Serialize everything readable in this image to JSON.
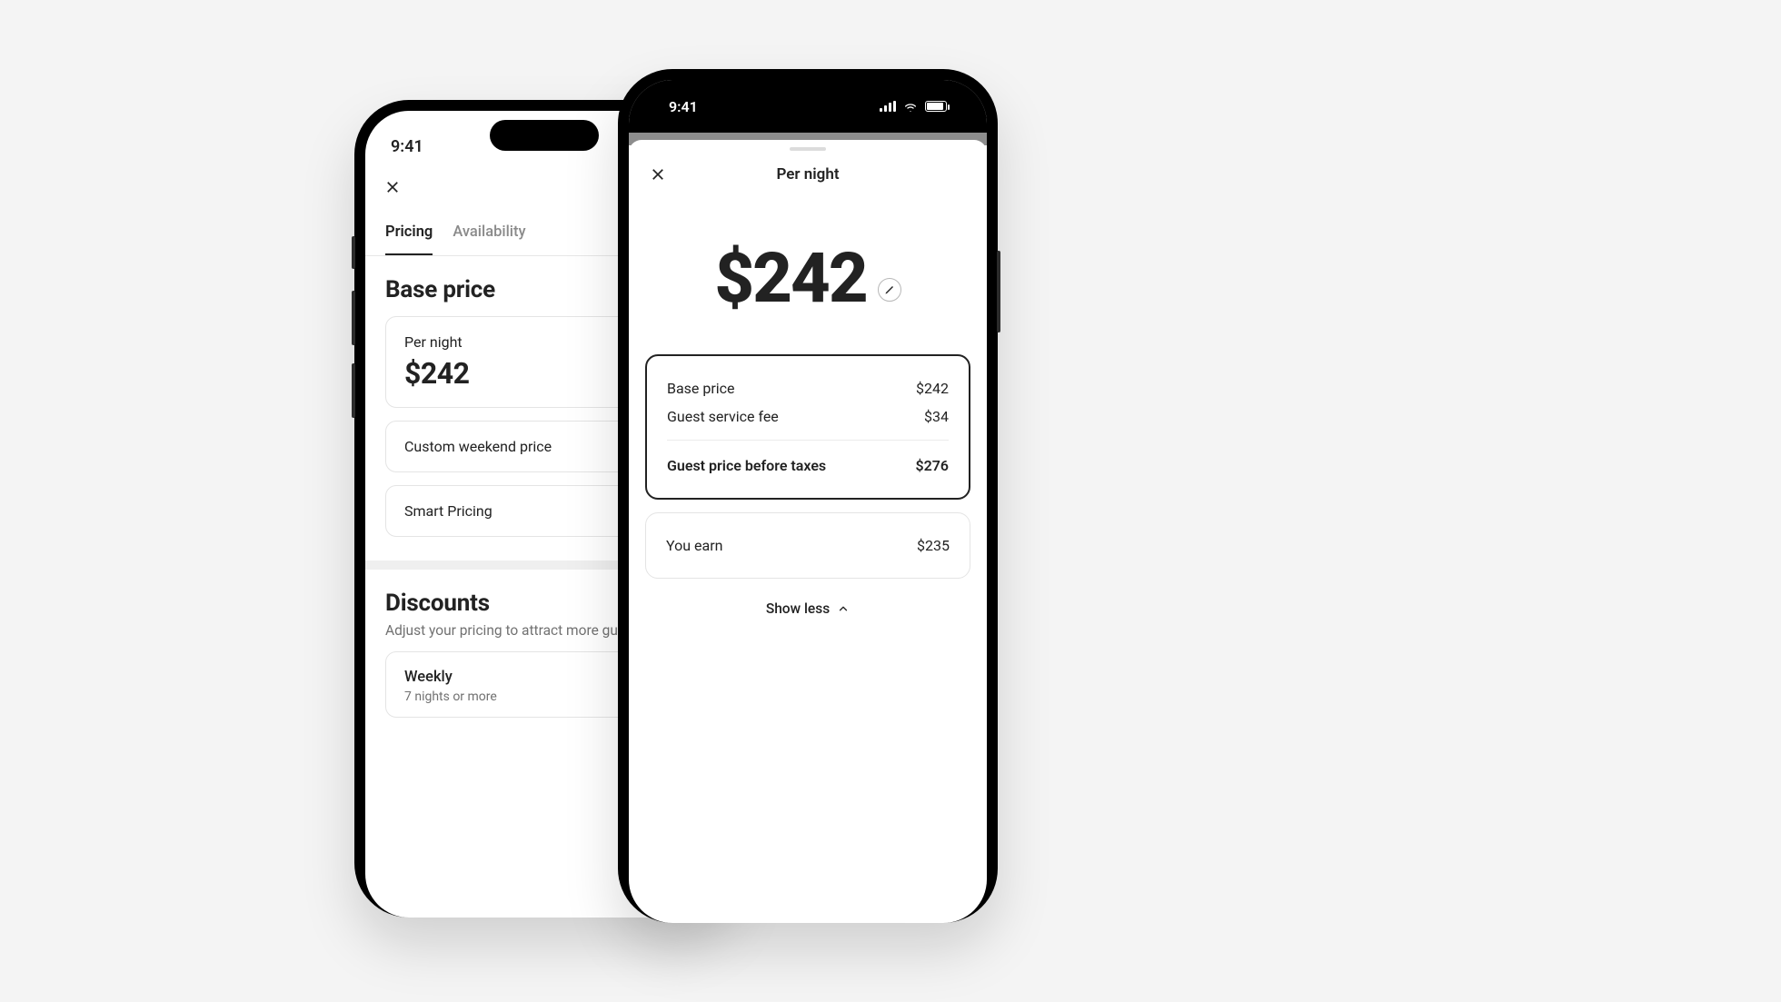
{
  "status_time": "9:41",
  "left": {
    "tabs": {
      "pricing": "Pricing",
      "availability": "Availability"
    },
    "base_price_heading": "Base price",
    "per_night_card": {
      "label": "Per night",
      "price": "$242"
    },
    "custom_weekend_label": "Custom weekend price",
    "smart_pricing_label": "Smart Pricing",
    "discounts_heading": "Discounts",
    "discounts_sub": "Adjust your pricing to attract more guests",
    "weekly_card": {
      "title": "Weekly",
      "sub": "7 nights or more"
    }
  },
  "right": {
    "sheet_title": "Per night",
    "hero_price": "$242",
    "breakdown": {
      "base_price_label": "Base price",
      "base_price_value": "$242",
      "service_fee_label": "Guest service fee",
      "service_fee_value": "$34",
      "guest_total_label": "Guest price before taxes",
      "guest_total_value": "$276"
    },
    "you_earn_label": "You earn",
    "you_earn_value": "$235",
    "show_less": "Show less"
  }
}
